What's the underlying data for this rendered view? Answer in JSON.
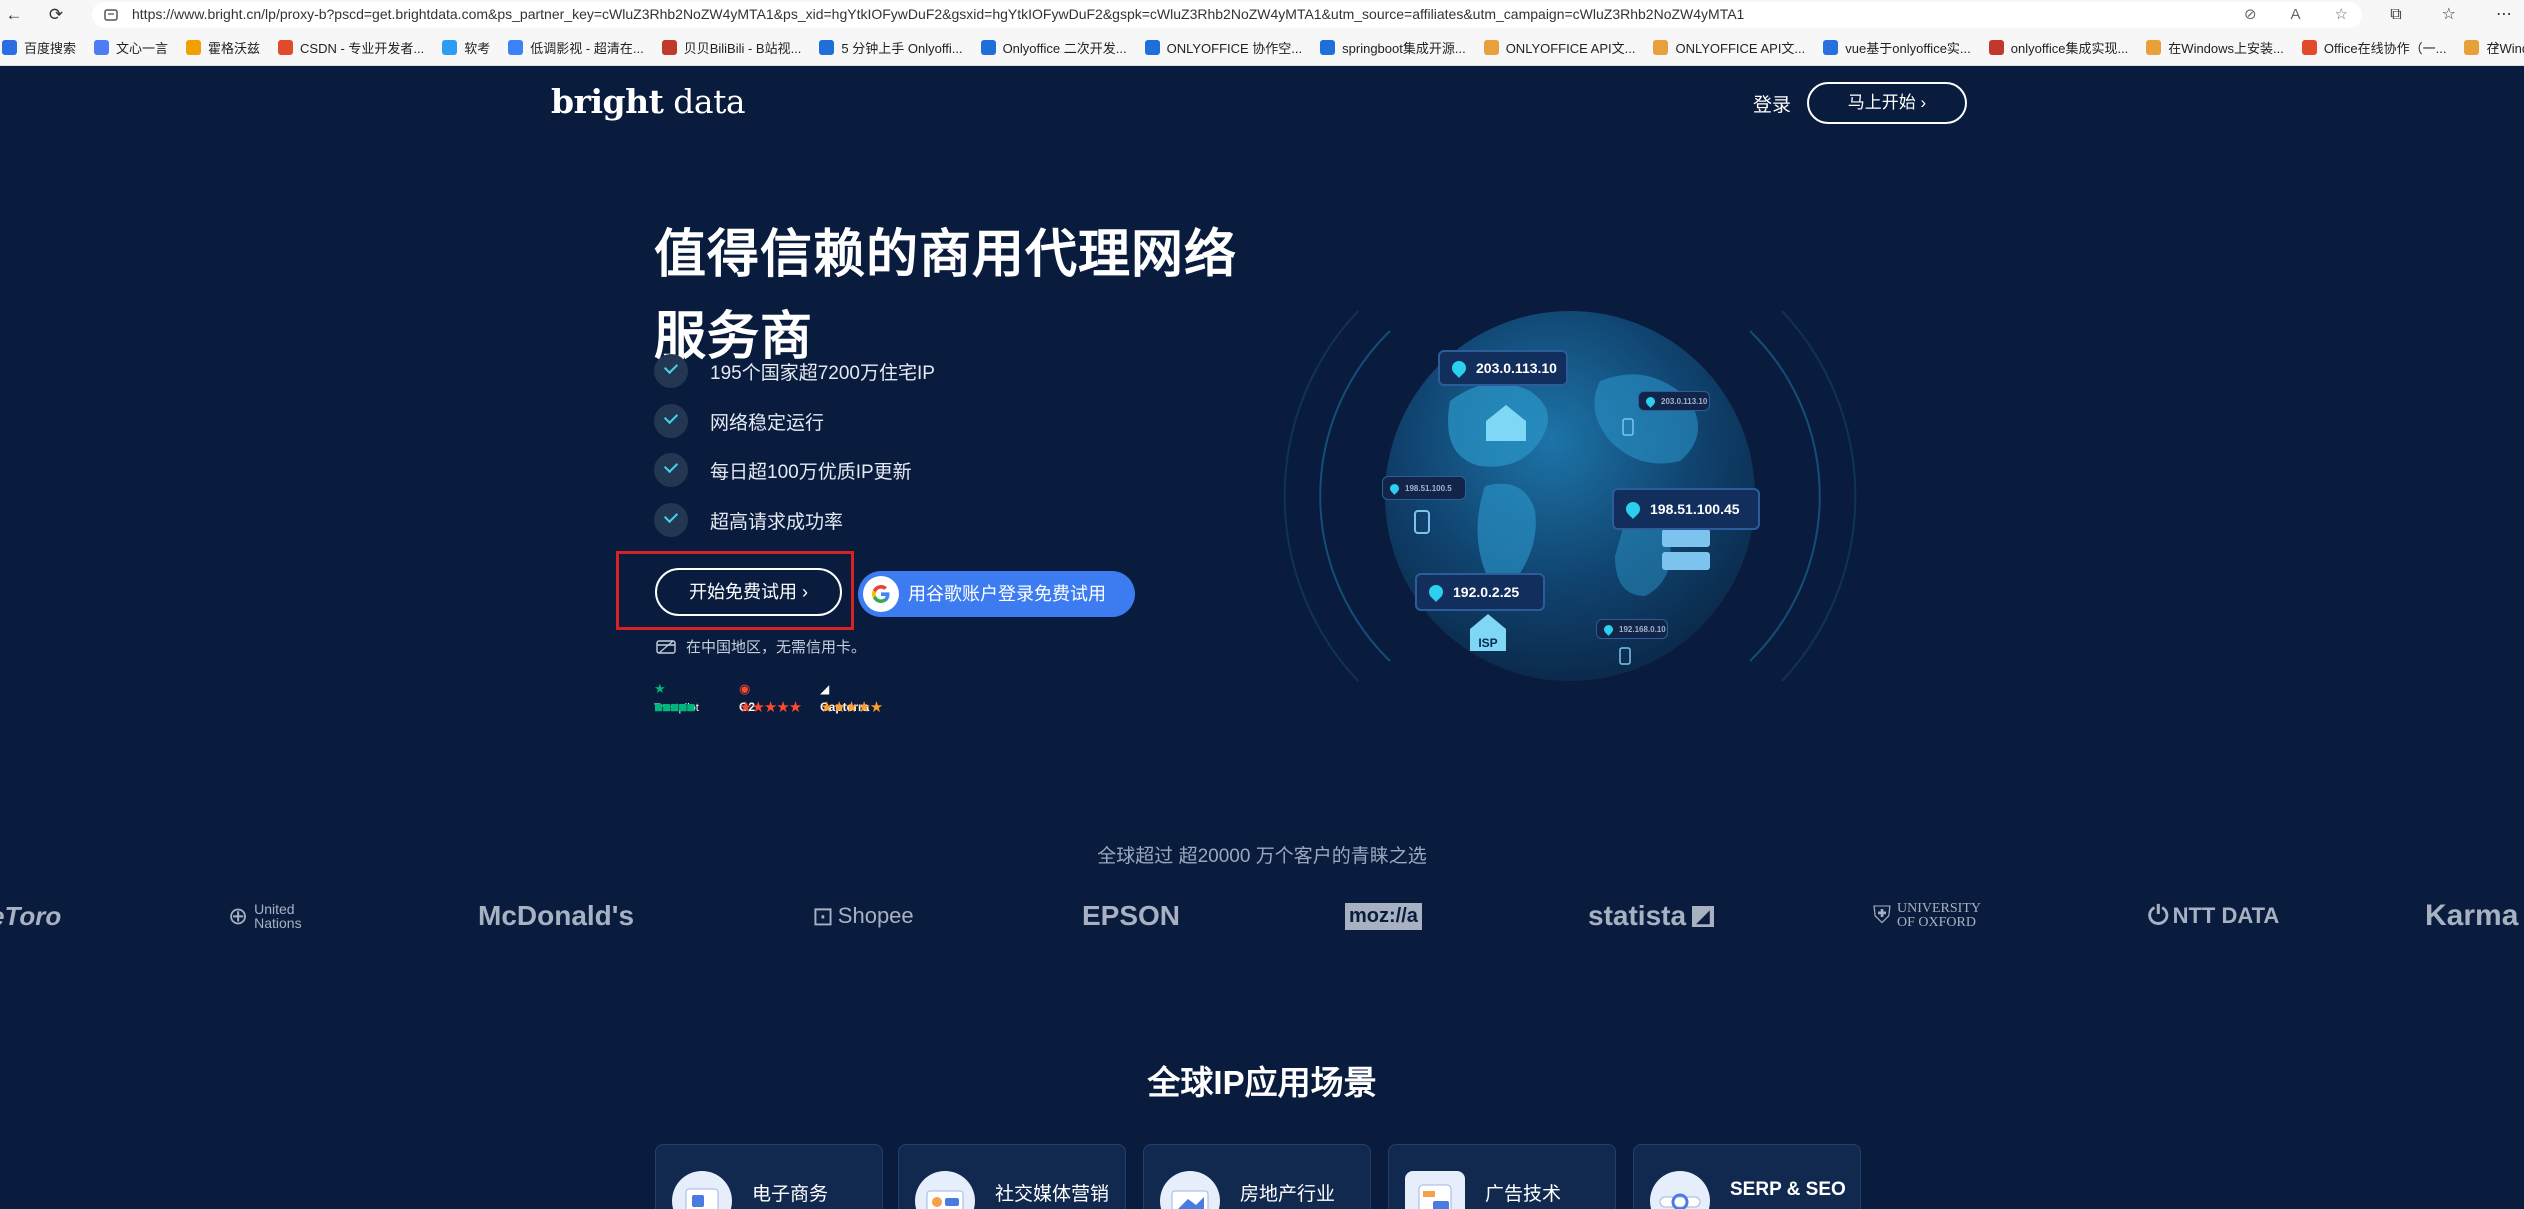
{
  "browser": {
    "url": "https://www.bright.cn/lp/proxy-b?pscd=get.brightdata.com&ps_partner_key=cWluZ3Rhb2NoZW4yMTA1&ps_xid=hgYtkIOFywDuF2&gsxid=hgYtkIOFywDuF2&gspk=cWluZ3Rhb2NoZW4yMTA1&utm_source=affiliates&utm_campaign=cWluZ3Rhb2NoZW4yMTA1",
    "bookmarks": [
      {
        "label": "百度搜索",
        "color": "#2b6de3"
      },
      {
        "label": "文心一言",
        "color": "#4e7cf5"
      },
      {
        "label": "霍格沃兹",
        "color": "#f0a000"
      },
      {
        "label": "CSDN - 专业开发者...",
        "color": "#e24a2b"
      },
      {
        "label": "软考",
        "color": "#2a9df4"
      },
      {
        "label": "低调影视 - 超清在...",
        "color": "#3b82f6"
      },
      {
        "label": "贝贝BiliBili - B站视...",
        "color": "#c0392b"
      },
      {
        "label": "5 分钟上手 Onlyoffi...",
        "color": "#1e6fd9"
      },
      {
        "label": "Onlyoffice 二次开发...",
        "color": "#1e6fd9"
      },
      {
        "label": "ONLYOFFICE 协作空...",
        "color": "#1e6fd9"
      },
      {
        "label": "springboot集成开源...",
        "color": "#1e6fd9"
      },
      {
        "label": "ONLYOFFICE API文...",
        "color": "#e8a13a"
      },
      {
        "label": "ONLYOFFICE API文...",
        "color": "#e8a13a"
      },
      {
        "label": "vue基于onlyoffice实...",
        "color": "#2a6fe0"
      },
      {
        "label": "onlyoffice集成实现...",
        "color": "#c0392b"
      },
      {
        "label": "在Windows上安装...",
        "color": "#e8a13a"
      },
      {
        "label": "Office在线协作（一...",
        "color": "#e24a2b"
      },
      {
        "label": "在Windows上安装...",
        "color": "#e8a13a"
      }
    ]
  },
  "header": {
    "logo_bold": "bright",
    "logo_light": " data",
    "login": "登录",
    "start": "马上开始"
  },
  "hero": {
    "title": "值得信赖的商用代理网络服务商",
    "features": [
      "195个国家超7200万住宅IP",
      "网络稳定运行",
      "每日超100万优质IP更新",
      "超高请求成功率"
    ],
    "trial_button": "开始免费试用",
    "google_button": "用谷歌账户登录免费试用",
    "card_note": "在中国地区，无需信用卡。",
    "ratings": {
      "trustpilot": "Trustpilot",
      "g2": "G2",
      "capterra": "Capterra"
    }
  },
  "globe": {
    "tags": [
      "203.0.113.10",
      "198.51.100.45",
      "192.0.2.25",
      "198.51.100.5",
      "203.0.113.10",
      "192.168.0.10"
    ],
    "isp": "ISP"
  },
  "trust": {
    "caption": "全球超过 超20000 万个客户的青睐之选",
    "brands": [
      "eToro",
      "United Nations",
      "McDonald's",
      "Shopee",
      "EPSON",
      "moz://a",
      "statista",
      "UNIVERSITY OF OXFORD",
      "NTT DATA",
      "Karma"
    ]
  },
  "usecases": {
    "title": "全球IP应用场景",
    "items": [
      "电子商务",
      "社交媒体营销",
      "房地产行业",
      "广告技术",
      "SERP & SEO"
    ]
  },
  "colors": {
    "page_bg": "#0a1c3d",
    "accent_cyan": "#2ad0ee",
    "google_blue": "#3d7cf0",
    "highlight_red": "#d62222"
  }
}
